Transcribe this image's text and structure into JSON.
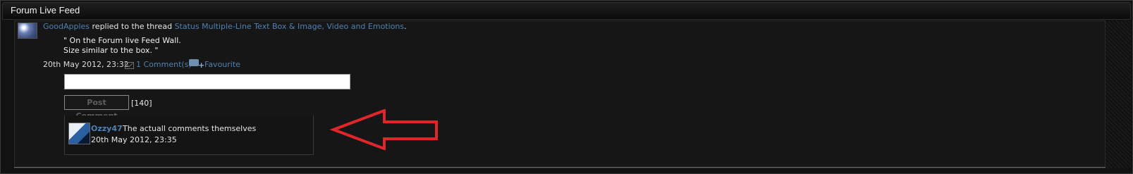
{
  "widget": {
    "title": "Forum Live Feed"
  },
  "post": {
    "user": "GoodApples",
    "action": "replied to the thread",
    "thread": "Status Multiple-Line Text Box & Image, Video and Emotions",
    "period": ".",
    "quote_line1": "\" On the Forum live Feed Wall.",
    "quote_line2": "Size similar to the box. \"",
    "timestamp": "20th May 2012, 23:32",
    "comments_link": "1 Comment(s)",
    "favourite_link": "Favourite"
  },
  "comment_form": {
    "input_value": "",
    "post_label": "Post Comment",
    "char_count": "[140]"
  },
  "comment": {
    "user": "Ozzy47",
    "text": "The actuall comments themselves",
    "timestamp": "20th May 2012, 23:35"
  },
  "annotation": {
    "arrow_color": "#e0262b"
  }
}
